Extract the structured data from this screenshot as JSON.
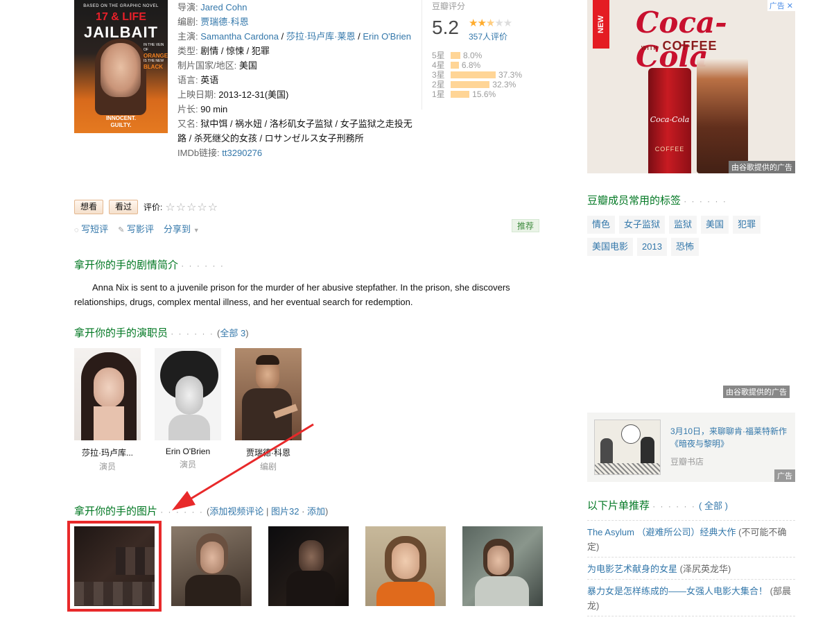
{
  "poster": {
    "top_line": "BASED ON THE GRAPHIC NOVEL",
    "title_line1": "17 & LIFE",
    "title_line2": "JAILBAIT",
    "side_text": "IN THE VEIN OF",
    "side_bold": "ORANGE",
    "side_text2": "IS THE NEW",
    "side_bold2": "BLACK",
    "footer1": "INNOCENT.",
    "footer2": "GUILTY."
  },
  "info": {
    "director_label": "导演: ",
    "director": "Jared Cohn",
    "writer_label": "编剧: ",
    "writer": "贾瑞德·科恩",
    "cast_label": "主演: ",
    "cast": [
      "Samantha Cardona",
      "莎拉·玛卢库·莱恩",
      "Erin O'Brien"
    ],
    "sep": " / ",
    "genre_label": "类型: ",
    "genres": "剧情 / 惊悚 / 犯罪",
    "country_label": "制片国家/地区: ",
    "country": "美国",
    "lang_label": "语言: ",
    "lang": "英语",
    "release_label": "上映日期: ",
    "release": "2013-12-31(美国)",
    "runtime_label": "片长: ",
    "runtime": "90 min",
    "aka_label": "又名: ",
    "aka": "狱中饵 / 祸水妞 / 洛杉矶女子监狱 / 女子监狱之走投无路 / 杀死继父的女孩 / ロサンゼルス女子刑務所",
    "imdb_label": "IMDb链接: ",
    "imdb": "tt3290276"
  },
  "rating": {
    "label": "豆瓣评分",
    "score": "5.2",
    "stars_full": "★★",
    "stars_half": "★",
    "stars_empty": "★★",
    "votes": "357人评价",
    "breakdown": [
      {
        "label": "5星",
        "pct": "8.0%",
        "value": 8.0
      },
      {
        "label": "4星",
        "pct": "6.8%",
        "value": 6.8
      },
      {
        "label": "3星",
        "pct": "37.3%",
        "value": 37.3
      },
      {
        "label": "2星",
        "pct": "32.3%",
        "value": 32.3
      },
      {
        "label": "1星",
        "pct": "15.6%",
        "value": 15.6
      }
    ]
  },
  "actions": {
    "want": "想看",
    "seen": "看过",
    "rate_label": "评价:",
    "rate_stars": "☆☆☆☆☆",
    "short_review": "写短评",
    "review": "写影评",
    "share": "分享到",
    "recommend": "推荐"
  },
  "summary": {
    "title": "拿开你的手的剧情简介",
    "dots": "· · · · · ·",
    "text": "Anna Nix is sent to a juvenile prison for the murder of her abusive stepfather. In the prison, she discovers relationships, drugs, complex mental illness, and her eventual search for redemption."
  },
  "cast_section": {
    "title": "拿开你的手的演职员",
    "dots": "· · · · · ·",
    "all_prefix": "(",
    "all": "全部 3",
    "all_suffix": ")",
    "members": [
      {
        "name": "莎拉·玛卢库...",
        "role": "演员"
      },
      {
        "name": "Erin O'Brien",
        "role": "演员"
      },
      {
        "name": "贾瑞德·科恩",
        "role": "编剧"
      }
    ]
  },
  "photos_section": {
    "title": "拿开你的手的图片",
    "dots": "· · · · · ·",
    "open": "(",
    "add_video": "添加视频评论",
    "bar": " | ",
    "pics": "图片32",
    "mid": " · ",
    "add": "添加",
    "close": ")"
  },
  "ad": {
    "new": "NEW",
    "brand": "Coca-Cola",
    "with": "WITH",
    "coffee": "COFFEE",
    "can_logo": "Coca-Cola",
    "can_text": "COFFEE",
    "tag": "由谷歌提供的广告",
    "close": "广告",
    "tag2": "由谷歌提供的广告"
  },
  "tags_section": {
    "title": "豆瓣成员常用的标签",
    "dots": "· · · · · ·",
    "tags": [
      "情色",
      "女子监狱",
      "监狱",
      "美国",
      "犯罪",
      "美国电影",
      "2013",
      "恐怖"
    ]
  },
  "book_ad": {
    "title": "3月10日，来聊聊肯·福莱特新作《暗夜与黎明》",
    "source": "豆瓣书店",
    "badge": "广告"
  },
  "lists_section": {
    "title": "以下片单推荐",
    "dots": "· · · · · ·",
    "all": "( 全部 )",
    "items": [
      {
        "link": "The Asylum （避难所公司）经典大作",
        "note": " (不可能不确定)"
      },
      {
        "link": "为电影艺术献身的女星",
        "note": " (泽尻英龙华)"
      },
      {
        "link": "暴力女是怎样练成的——女强人电影大集合！",
        "note": " (部晨龙)"
      }
    ]
  },
  "colors": {
    "link": "#3377aa",
    "section_title": "#007722",
    "annotation_red": "#e8292a",
    "star": "#ffac2d",
    "bar": "#ffd596"
  }
}
